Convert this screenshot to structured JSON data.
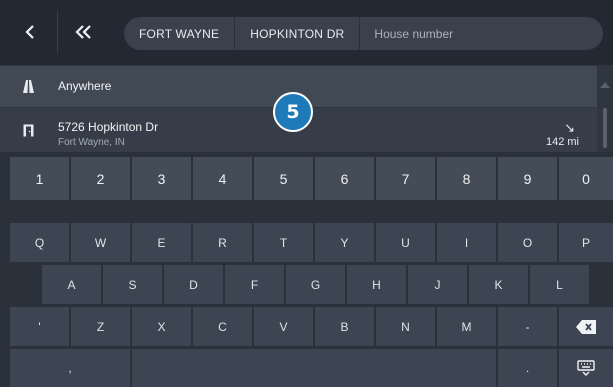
{
  "nav": {
    "back_icon": "chevron-left-icon",
    "first_icon": "double-chevron-left-icon"
  },
  "search": {
    "city": "FORT WAYNE",
    "street": "HOPKINTON DR",
    "house_placeholder": "House number"
  },
  "results": {
    "anywhere": {
      "icon": "road-icon",
      "label": "Anywhere"
    },
    "address": {
      "icon": "door-icon",
      "title": "5726 Hopkinton Dr",
      "subtitle": "Fort Wayne, IN",
      "direction_icon": "arrow-southeast-icon",
      "distance": "142 mi"
    }
  },
  "badge": "5",
  "keyboard": {
    "row_numbers": [
      "1",
      "2",
      "3",
      "4",
      "5",
      "6",
      "7",
      "8",
      "9",
      "0"
    ],
    "row_q": [
      "Q",
      "W",
      "E",
      "R",
      "T",
      "Y",
      "U",
      "I",
      "O",
      "P"
    ],
    "row_a": [
      "A",
      "S",
      "D",
      "F",
      "G",
      "H",
      "J",
      "K",
      "L"
    ],
    "row_z_left": "'",
    "row_z": [
      "Z",
      "X",
      "C",
      "V",
      "B",
      "N",
      "M"
    ],
    "row_z_dash": "-",
    "backspace_icon": "backspace-icon",
    "bottom_left": ",",
    "space": "",
    "bottom_dot": ".",
    "hide_icon": "keyboard-hide-icon"
  }
}
